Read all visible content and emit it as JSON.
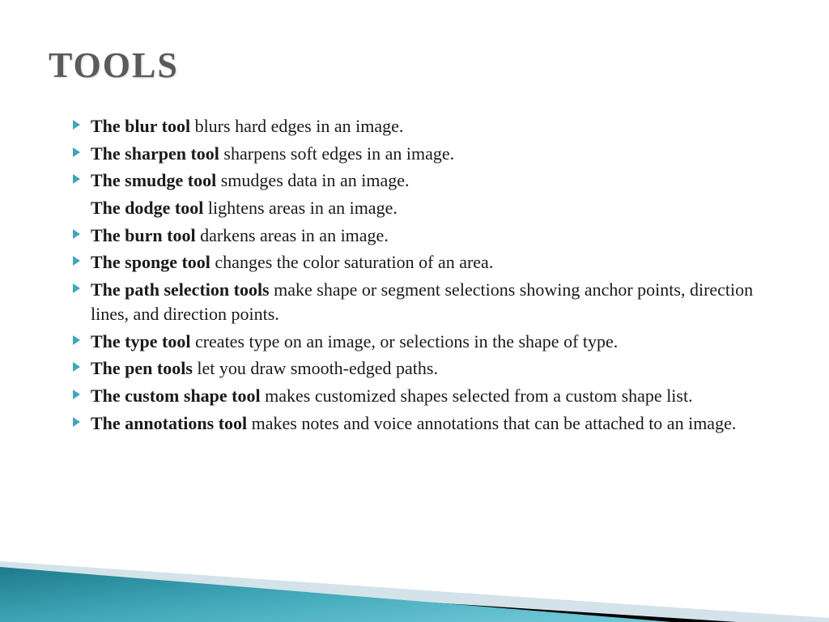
{
  "title": "TOOLS",
  "bullet_color": "#3fa7b8",
  "items": [
    {
      "has_bullet": true,
      "bold": "The blur tool",
      "rest": " blurs hard edges in an image."
    },
    {
      "has_bullet": true,
      "bold": "The sharpen tool",
      "rest": " sharpens soft edges in an image."
    },
    {
      "has_bullet": true,
      "bold": "The smudge tool",
      "rest": " smudges data in an image."
    },
    {
      "has_bullet": false,
      "bold": "The dodge tool",
      "rest": " lightens areas in an image."
    },
    {
      "has_bullet": true,
      "bold": "The burn tool",
      "rest": " darkens areas in an image."
    },
    {
      "has_bullet": true,
      "bold": "The sponge tool",
      "rest": " changes the color saturation of an area."
    },
    {
      "has_bullet": true,
      "bold": " The path selection tools",
      "rest": " make shape or segment selections showing anchor points, direction lines, and direction points."
    },
    {
      "has_bullet": true,
      "bold": " The type tool",
      "rest": " creates type on an image, or selections in the shape of type."
    },
    {
      "has_bullet": true,
      "bold": " The pen tools",
      "rest": " let you draw smooth-edged paths."
    },
    {
      "has_bullet": true,
      "bold": "The custom shape tool",
      "rest": " makes customized shapes selected from a custom shape list."
    },
    {
      "has_bullet": true,
      "bold": " The annotations tool",
      "rest": " makes notes and voice annotations that can be attached to an image."
    }
  ]
}
